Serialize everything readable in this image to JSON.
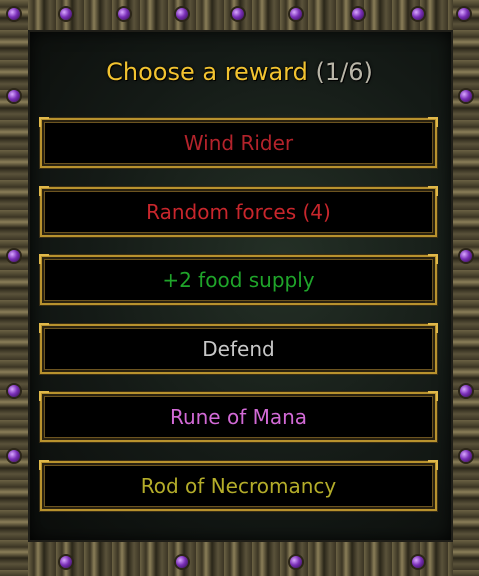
{
  "dialog": {
    "title": "Choose a reward",
    "count": "(1/6)",
    "colors": {
      "title": "#f2c330",
      "count": "#b9b6a8",
      "button_border": "#b8922e"
    }
  },
  "rewards": [
    {
      "label": "Wind Rider",
      "color": "#b3232b"
    },
    {
      "label": "Random forces (4)",
      "color": "#c8262c"
    },
    {
      "label": "+2 food supply",
      "color": "#1fa52a"
    },
    {
      "label": "Defend",
      "color": "#c8c8c8"
    },
    {
      "label": "Rune of Mana",
      "color": "#d26ad6"
    },
    {
      "label": "Rod of Necromancy",
      "color": "#b4ad2a"
    }
  ]
}
